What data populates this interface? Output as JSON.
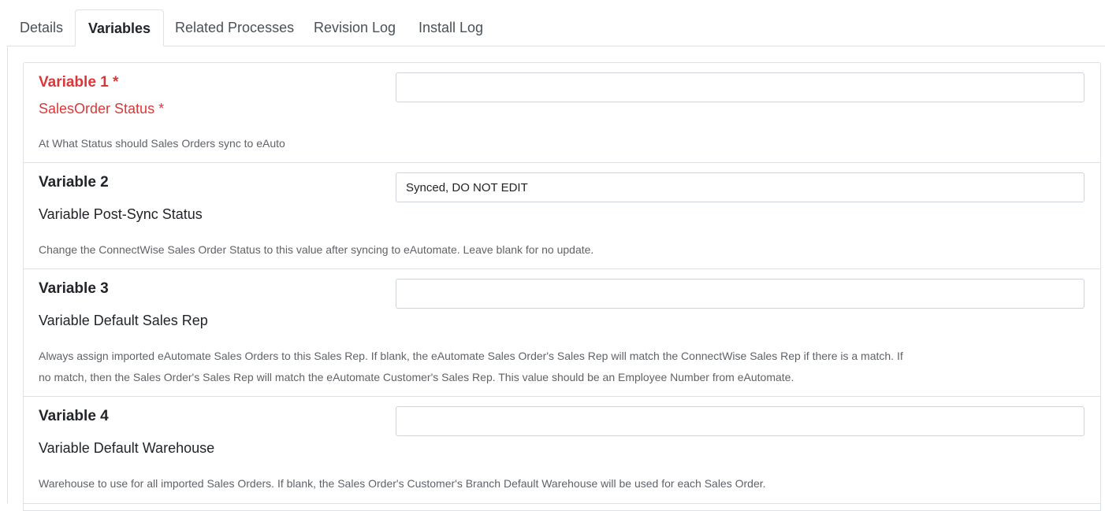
{
  "tabs": [
    {
      "label": "Details",
      "active": false
    },
    {
      "label": "Variables",
      "active": true
    },
    {
      "label": "Related Processes",
      "active": false
    },
    {
      "label": "Revision Log",
      "active": false
    },
    {
      "label": "Install Log",
      "active": false
    }
  ],
  "variables": [
    {
      "title": "Variable 1 *",
      "name": "SalesOrder Status *",
      "value": "",
      "required": true,
      "description": "At What Status should Sales Orders sync to eAuto"
    },
    {
      "title": "Variable 2",
      "name": "Variable Post-Sync Status",
      "value": "Synced, DO NOT EDIT",
      "required": false,
      "description": "Change the ConnectWise Sales Order Status to this value after syncing to eAutomate. Leave blank for no update."
    },
    {
      "title": "Variable 3",
      "name": "Variable Default Sales Rep",
      "value": "",
      "required": false,
      "description_lines": [
        "Always assign imported eAutomate Sales Orders to this Sales Rep. If blank, the eAutomate Sales Order's Sales Rep will match the ConnectWise Sales Rep if there is a match. If",
        "no match, then the Sales Order's Sales Rep will match the eAutomate Customer's Sales Rep. This value should be an Employee Number from eAutomate."
      ]
    },
    {
      "title": "Variable 4",
      "name": "Variable Default Warehouse",
      "value": "",
      "required": false,
      "description": "Warehouse to use for all imported Sales Orders. If blank, the Sales Order's Customer's Branch Default Warehouse will be used for each Sales Order."
    }
  ],
  "colors": {
    "required": "#d9383a",
    "border": "#dee2e6",
    "muted_text": "#5f6368"
  }
}
